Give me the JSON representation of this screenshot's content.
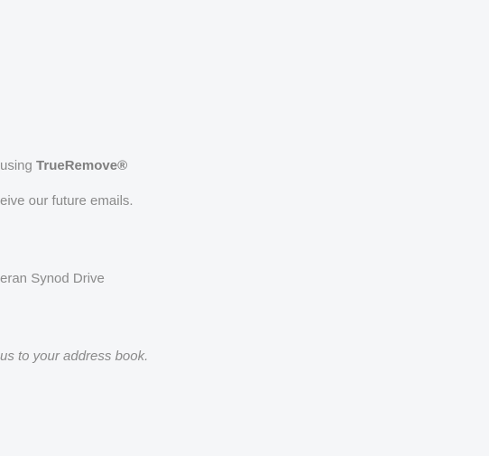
{
  "footer": {
    "line1_prefix": "using ",
    "line1_brand": "TrueRemove®",
    "line2": "eive our future emails.",
    "line3": "eran Synod Drive",
    "line4": "us to your address book."
  },
  "colors": {
    "background": "#f5f6f8",
    "text": "#8a8a8a",
    "brand_text": "#7f7f7f"
  }
}
